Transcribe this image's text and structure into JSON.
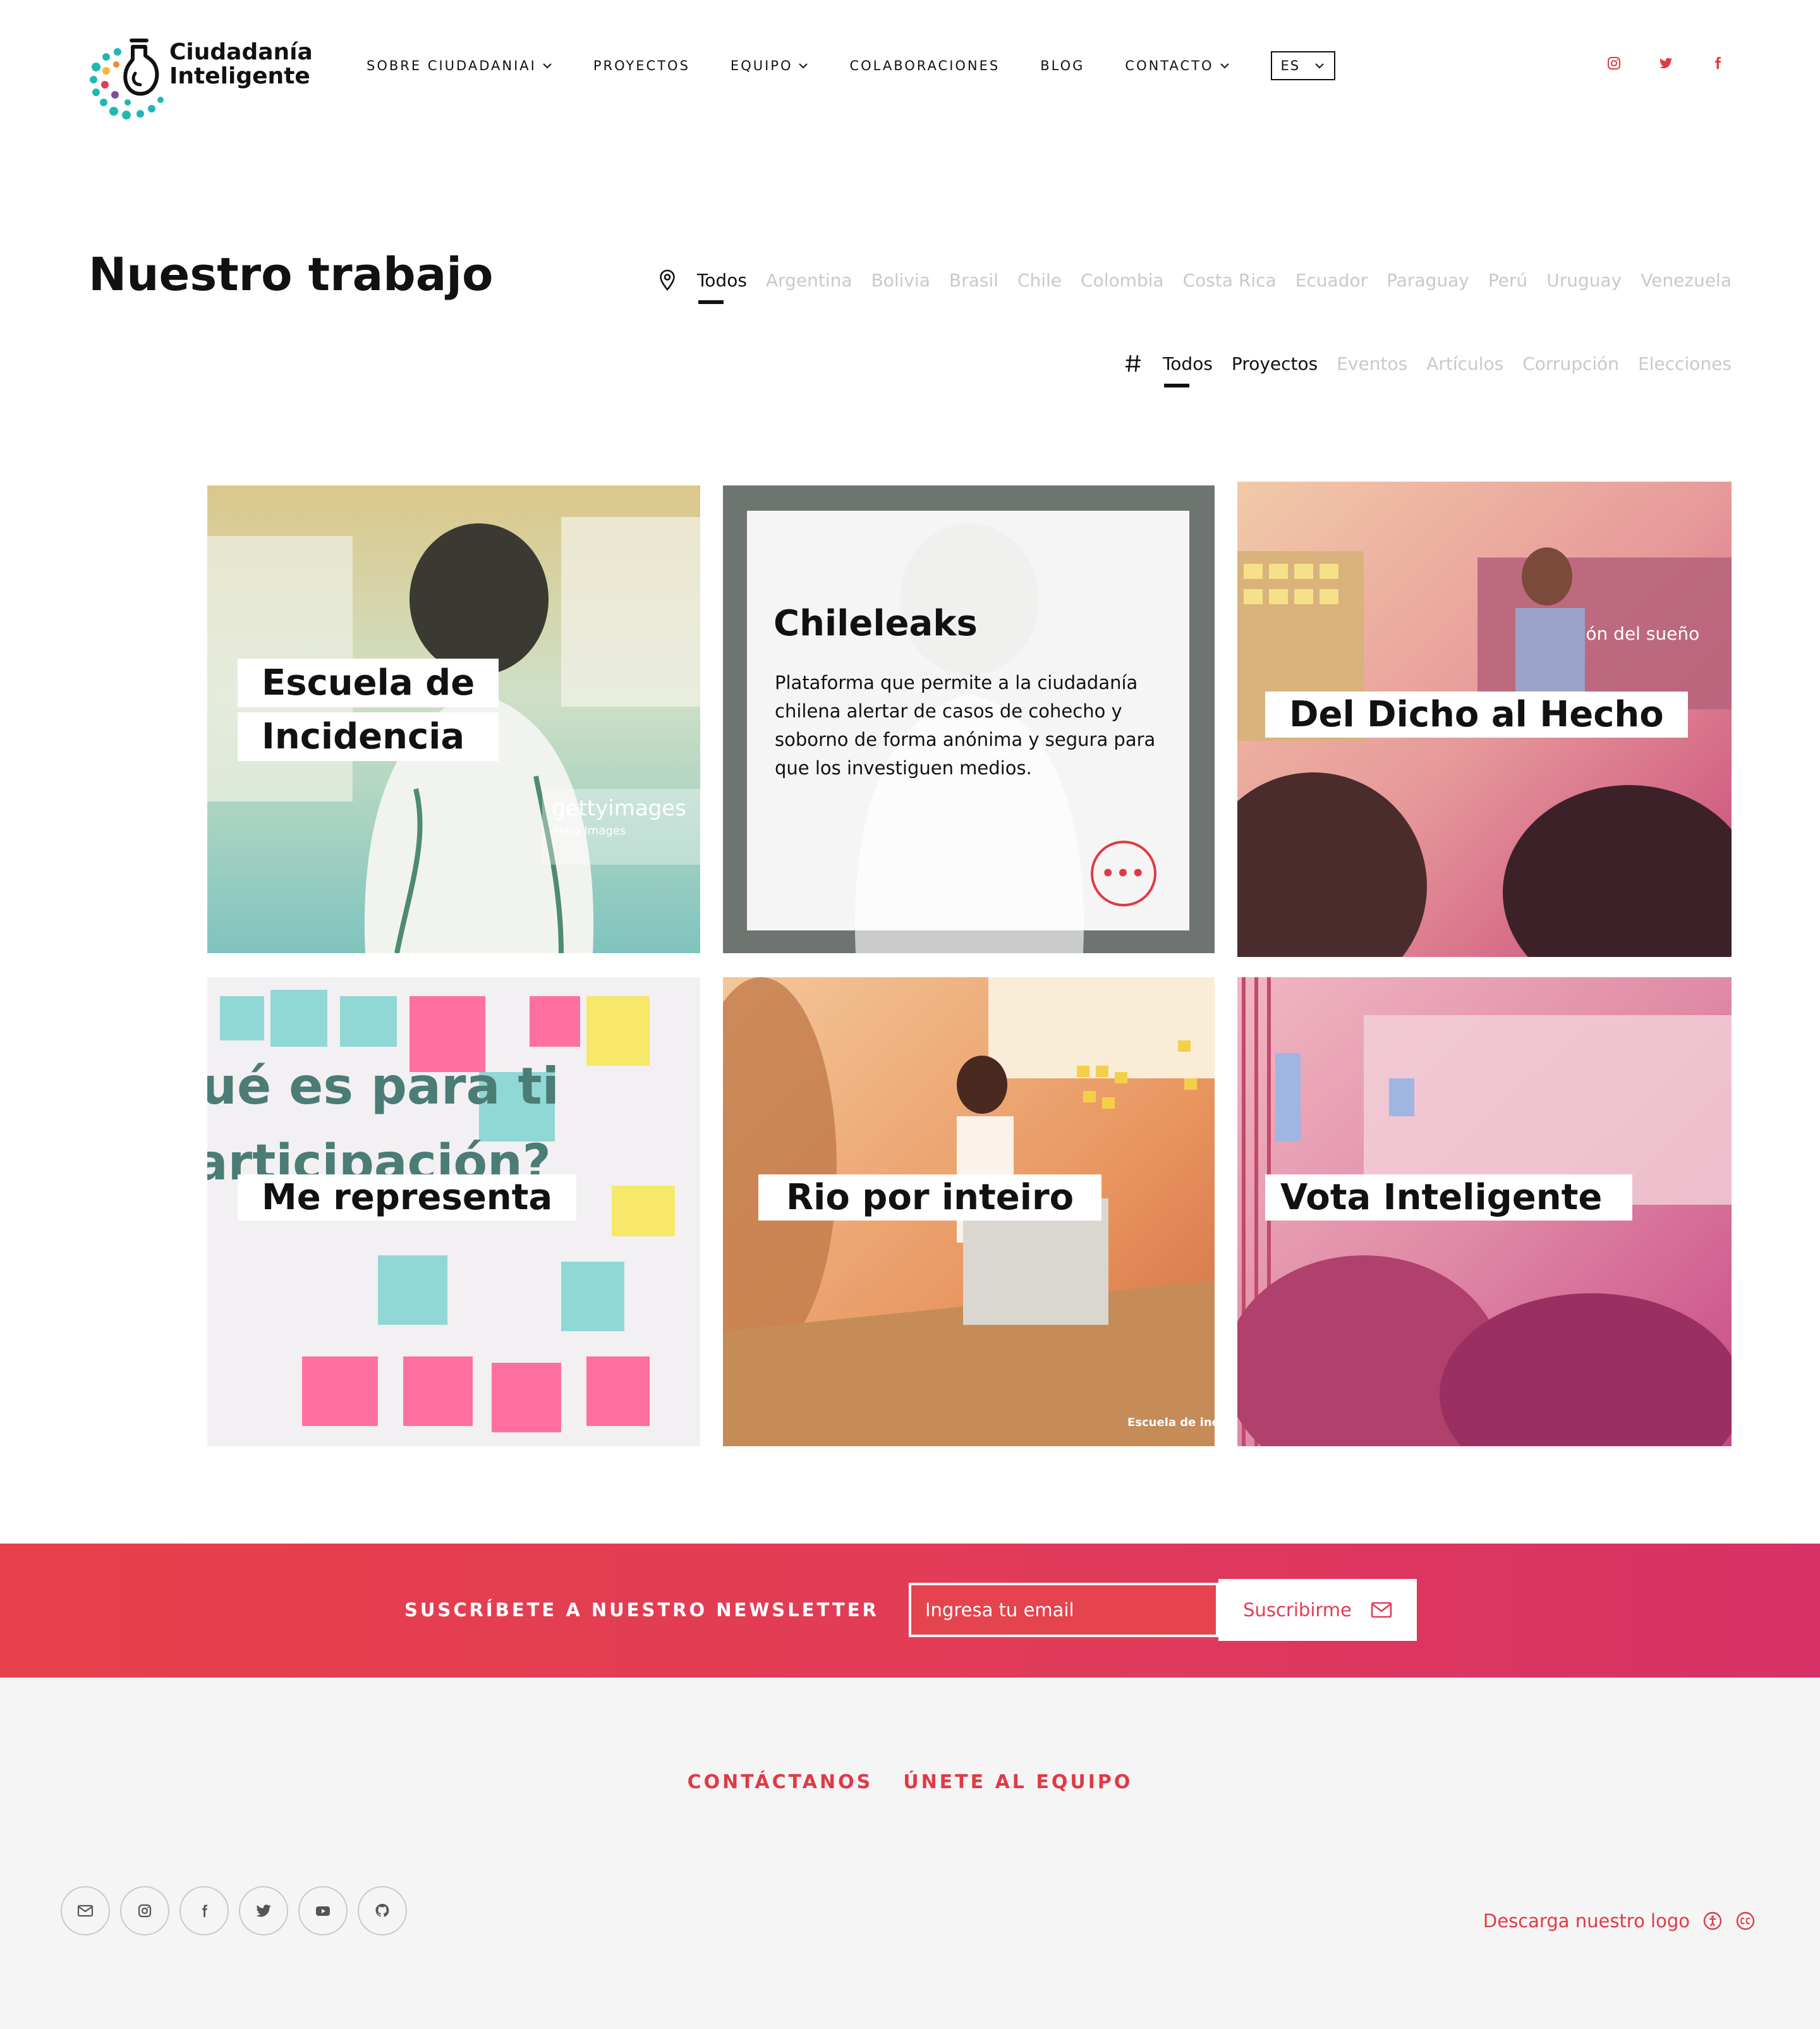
{
  "header": {
    "logo_line1": "Ciudadanía",
    "logo_line2": "Inteligente",
    "nav": [
      {
        "label": "SOBRE CIUDADANIAI",
        "dropdown": true
      },
      {
        "label": "PROYECTOS",
        "dropdown": false
      },
      {
        "label": "EQUIPO",
        "dropdown": true
      },
      {
        "label": "COLABORACIONES",
        "dropdown": false
      },
      {
        "label": "BLOG",
        "dropdown": false
      },
      {
        "label": "CONTACTO",
        "dropdown": true
      }
    ],
    "language": "ES",
    "social": [
      "instagram-icon",
      "twitter-icon",
      "facebook-icon"
    ],
    "accent_color": "#e03a45"
  },
  "page": {
    "title": "Nuestro trabajo",
    "countries": [
      "Todos",
      "Argentina",
      "Bolivia",
      "Brasil",
      "Chile",
      "Colombia",
      "Costa Rica",
      "Ecuador",
      "Paraguay",
      "Perú",
      "Uruguay",
      "Venezuela"
    ],
    "countries_active": "Todos",
    "tags": [
      "Todos",
      "Proyectos",
      "Eventos",
      "Artículos",
      "Corrupción",
      "Elecciones"
    ],
    "tags_active": "Todos"
  },
  "cards": [
    {
      "title_line1": "Escuela de",
      "title_line2": "Incidencia"
    },
    {
      "title": "Chileleaks",
      "description": "Plataforma que permite a la ciudadanía chilena alertar de casos de cohecho y soborno de forma anónima y segura para que los investiguen medios.",
      "more": "•••"
    },
    {
      "title": "Del Dicho al Hecho"
    },
    {
      "title": "Me representa"
    },
    {
      "title": "Rio por inteiro"
    },
    {
      "title": "Vota Inteligente"
    }
  ],
  "photo_text": {
    "getty": "gettyimages",
    "getty_sub": "Hero Images",
    "slide": "strucción del sueño",
    "poster_1": "ué es para ti",
    "poster_2": "articipación?",
    "escuela_logo": "Escuela de incidencia"
  },
  "newsletter": {
    "label": "SUSCRÍBETE A NUESTRO NEWSLETTER",
    "placeholder": "Ingresa tu email",
    "button": "Suscribirme"
  },
  "footer": {
    "links": [
      "CONTÁCTANOS",
      "ÚNETE AL EQUIPO"
    ],
    "social": [
      "mail-icon",
      "instagram-icon",
      "facebook-icon",
      "twitter-icon",
      "youtube-icon",
      "github-icon"
    ],
    "download_logo": "Descarga nuestro logo"
  }
}
